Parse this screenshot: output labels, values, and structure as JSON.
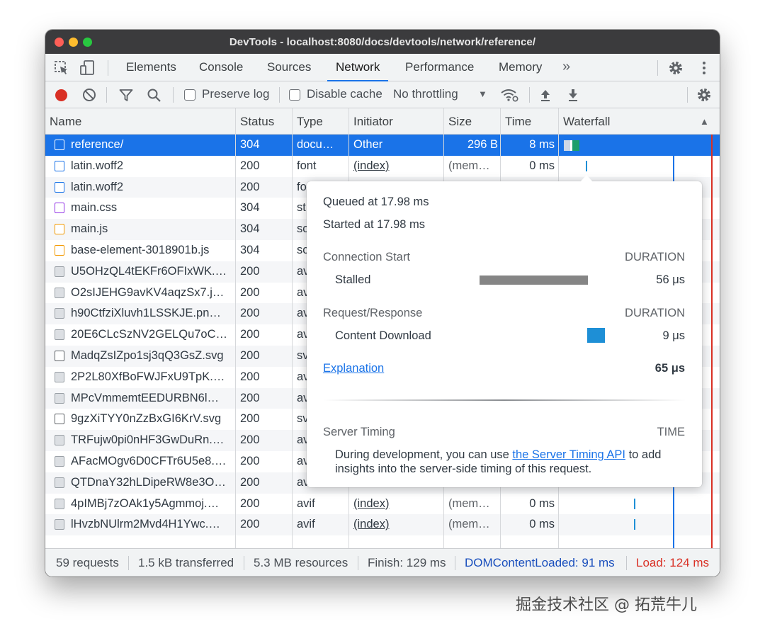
{
  "window": {
    "title": "DevTools - localhost:8080/docs/devtools/network/reference/"
  },
  "tabs": [
    "Elements",
    "Console",
    "Sources",
    "Network",
    "Performance",
    "Memory"
  ],
  "tabs_more": "»",
  "toolbar": {
    "preserve_log": "Preserve log",
    "disable_cache": "Disable cache",
    "throttling": "No throttling",
    "throttling_caret": "▼"
  },
  "columns": {
    "name": "Name",
    "status": "Status",
    "type": "Type",
    "initiator": "Initiator",
    "size": "Size",
    "time": "Time",
    "waterfall": "Waterfall",
    "sort_indicator": "▲"
  },
  "rows": [
    {
      "name": "reference/",
      "status": "304",
      "type": "docu…",
      "initiator": "Other",
      "size": "296 B",
      "time": "8 ms",
      "icon": "document-icon"
    },
    {
      "name": "latin.woff2",
      "status": "200",
      "type": "font",
      "initiator": "(index)",
      "size": "(mem…",
      "time": "0 ms",
      "icon": "font-icon"
    },
    {
      "name": "latin.woff2",
      "status": "200",
      "type": "fo",
      "initiator": "",
      "size": "",
      "time": "",
      "icon": "font-icon"
    },
    {
      "name": "main.css",
      "status": "304",
      "type": "st",
      "initiator": "",
      "size": "",
      "time": "",
      "icon": "stylesheet-icon"
    },
    {
      "name": "main.js",
      "status": "304",
      "type": "sc",
      "initiator": "",
      "size": "",
      "time": "",
      "icon": "script-icon"
    },
    {
      "name": "base-element-3018901b.js",
      "status": "304",
      "type": "sc",
      "initiator": "",
      "size": "",
      "time": "",
      "icon": "script-icon"
    },
    {
      "name": "U5OHzQL4tEKFr6OFIxWK.…",
      "status": "200",
      "type": "av",
      "initiator": "",
      "size": "",
      "time": "",
      "icon": "image-icon"
    },
    {
      "name": "O2sIJEHG9avKV4aqzSx7.j…",
      "status": "200",
      "type": "av",
      "initiator": "",
      "size": "",
      "time": "",
      "icon": "image-icon"
    },
    {
      "name": "h90CtfziXluvh1LSSKJE.pn…",
      "status": "200",
      "type": "av",
      "initiator": "",
      "size": "",
      "time": "",
      "icon": "image-icon"
    },
    {
      "name": "20E6CLcSzNV2GELQu7oC…",
      "status": "200",
      "type": "av",
      "initiator": "",
      "size": "",
      "time": "",
      "icon": "image-icon"
    },
    {
      "name": "MadqZsIZpo1sj3qQ3GsZ.svg",
      "status": "200",
      "type": "sv",
      "initiator": "",
      "size": "",
      "time": "",
      "icon": "svg-icon"
    },
    {
      "name": "2P2L80XfBoFWJFxU9TpK.…",
      "status": "200",
      "type": "av",
      "initiator": "",
      "size": "",
      "time": "",
      "icon": "image-icon"
    },
    {
      "name": "MPcVmmemtEEDURBN6l…",
      "status": "200",
      "type": "av",
      "initiator": "",
      "size": "",
      "time": "",
      "icon": "image-icon"
    },
    {
      "name": "9gzXiTYY0nZzBxGI6KrV.svg",
      "status": "200",
      "type": "sv",
      "initiator": "",
      "size": "",
      "time": "",
      "icon": "svg-icon"
    },
    {
      "name": "TRFujw0pi0nHF3GwDuRn.…",
      "status": "200",
      "type": "av",
      "initiator": "",
      "size": "",
      "time": "",
      "icon": "image-icon"
    },
    {
      "name": "AFacMOgv6D0CFTr6U5e8.…",
      "status": "200",
      "type": "av",
      "initiator": "",
      "size": "",
      "time": "",
      "icon": "image-icon"
    },
    {
      "name": "QTDnaY32hLDipeRW8e3O…",
      "status": "200",
      "type": "av",
      "initiator": "",
      "size": "",
      "time": "",
      "icon": "image-icon"
    },
    {
      "name": "4pIMBj7zOAk1y5Agmmoj.…",
      "status": "200",
      "type": "avif",
      "initiator": "(index)",
      "size": "(mem…",
      "time": "0 ms",
      "icon": "image-icon"
    },
    {
      "name": "lHvzbNUlrm2Mvd4H1Ywc.…",
      "status": "200",
      "type": "avif",
      "initiator": "(index)",
      "size": "(mem…",
      "time": "0 ms",
      "icon": "image-icon"
    }
  ],
  "popup": {
    "queued": "Queued at 17.98 ms",
    "started": "Started at 17.98 ms",
    "connection_start": "Connection Start",
    "duration_1": "DURATION",
    "stalled_label": "Stalled",
    "stalled_value": "56 μs",
    "request_response": "Request/Response",
    "duration_2": "DURATION",
    "content_download_label": "Content Download",
    "content_download_value": "9 μs",
    "explanation": "Explanation",
    "total": "65 μs",
    "server_timing": "Server Timing",
    "time_label": "TIME",
    "desc_before": "During development, you can use ",
    "desc_link": "the Server Timing API",
    "desc_after": " to add",
    "desc_line2": "insights into the server-side timing of this request."
  },
  "status": {
    "requests": "59 requests",
    "transferred": "1.5 kB transferred",
    "resources": "5.3 MB resources",
    "finish": "Finish: 129 ms",
    "dom_content_loaded": "DOMContentLoaded: 91 ms",
    "load": "Load: 124 ms"
  },
  "colors": {
    "accent": "#1a73e8",
    "record": "#d93025",
    "load_line": "#d93025",
    "dcl_line": "#1a73e8",
    "stalled_bar": "#858585",
    "download_bar": "#1e8fd6"
  },
  "watermark": "掘金技术社区 @ 拓荒牛儿"
}
